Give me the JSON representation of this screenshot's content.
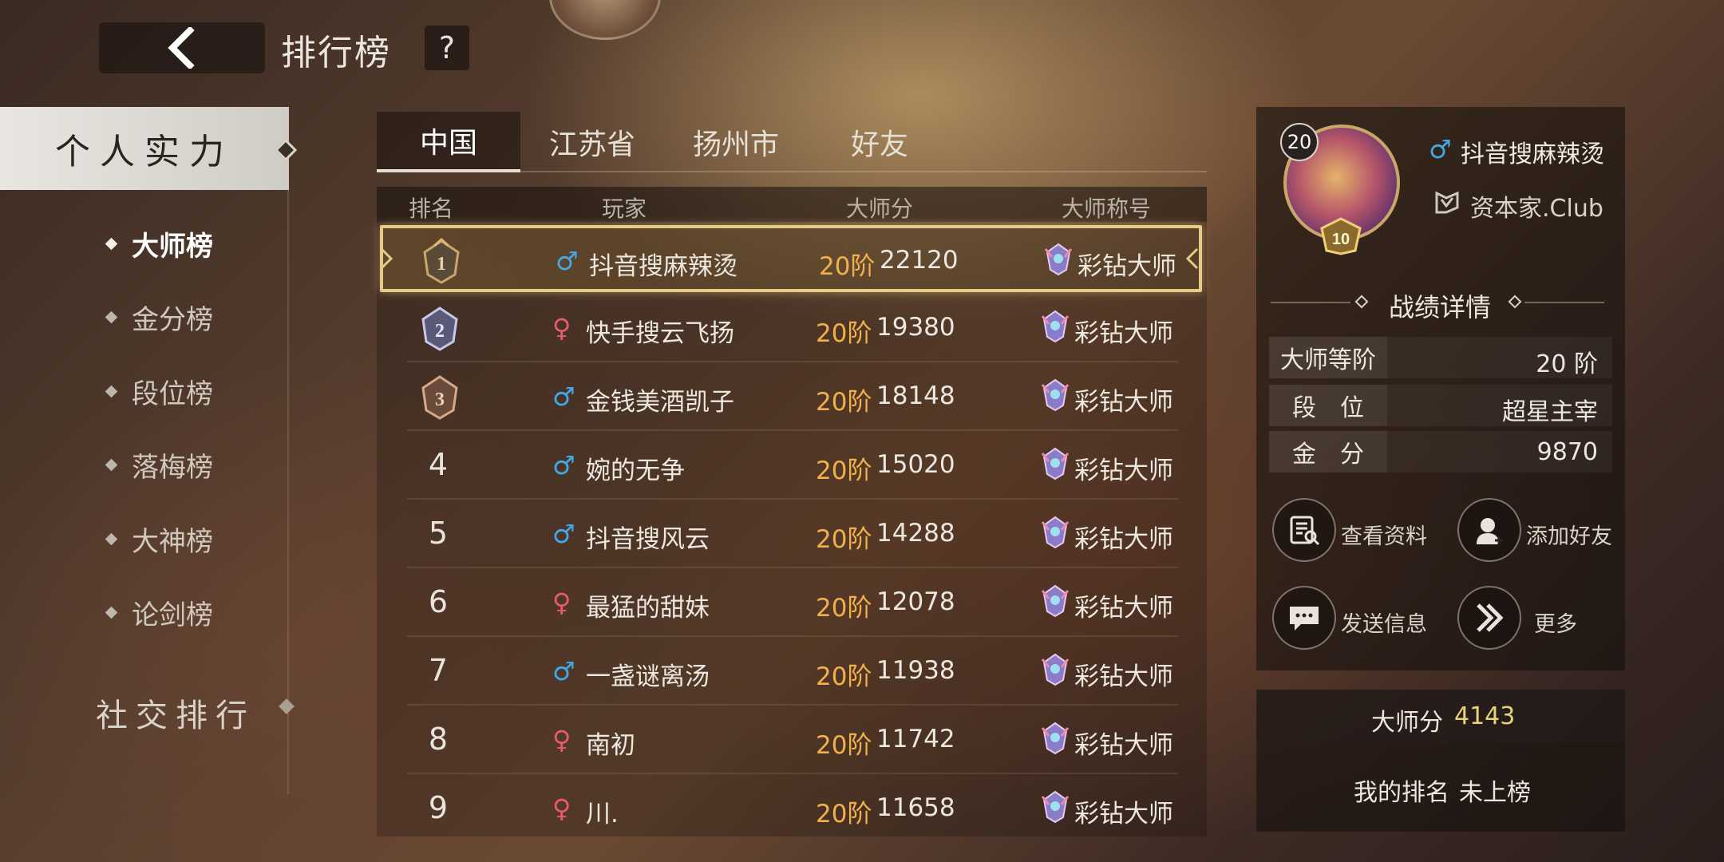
{
  "header": {
    "title": "排行榜",
    "help_label": "?"
  },
  "sidebar": {
    "main_label": "个人实力",
    "items": [
      {
        "label": "大师榜",
        "active": true
      },
      {
        "label": "金分榜",
        "active": false
      },
      {
        "label": "段位榜",
        "active": false
      },
      {
        "label": "落梅榜",
        "active": false
      },
      {
        "label": "大神榜",
        "active": false
      },
      {
        "label": "论剑榜",
        "active": false
      }
    ],
    "social_label": "社交排行"
  },
  "tabs": [
    {
      "label": "中国",
      "active": true
    },
    {
      "label": "江苏省",
      "active": false
    },
    {
      "label": "扬州市",
      "active": false
    },
    {
      "label": "好友",
      "active": false
    }
  ],
  "table": {
    "headers": [
      "排名",
      "玩家",
      "大师分",
      "大师称号"
    ],
    "rows": [
      {
        "rank": "1",
        "gender": "male",
        "name": "抖音搜麻辣烫",
        "tier": "20阶",
        "score": "22120",
        "title": "彩钻大师"
      },
      {
        "rank": "2",
        "gender": "female",
        "name": "快手搜云飞扬",
        "tier": "20阶",
        "score": "19380",
        "title": "彩钻大师"
      },
      {
        "rank": "3",
        "gender": "male",
        "name": "金钱美酒凯子",
        "tier": "20阶",
        "score": "18148",
        "title": "彩钻大师"
      },
      {
        "rank": "4",
        "gender": "male",
        "name": "婉的无争",
        "tier": "20阶",
        "score": "15020",
        "title": "彩钻大师"
      },
      {
        "rank": "5",
        "gender": "male",
        "name": "抖音搜风云",
        "tier": "20阶",
        "score": "14288",
        "title": "彩钻大师"
      },
      {
        "rank": "6",
        "gender": "female",
        "name": "最猛的甜妹",
        "tier": "20阶",
        "score": "12078",
        "title": "彩钻大师"
      },
      {
        "rank": "7",
        "gender": "male",
        "name": "一盏谜离汤",
        "tier": "20阶",
        "score": "11938",
        "title": "彩钻大师"
      },
      {
        "rank": "8",
        "gender": "female",
        "name": "南初",
        "tier": "20阶",
        "score": "11742",
        "title": "彩钻大师"
      },
      {
        "rank": "9",
        "gender": "female",
        "name": "川.",
        "tier": "20阶",
        "score": "11658",
        "title": "彩钻大师"
      }
    ]
  },
  "detail": {
    "level": "20",
    "rank_badge": "10",
    "name": "抖音搜麻辣烫",
    "club": "资本家.Club",
    "section_title": "战绩详情",
    "stats": [
      {
        "label": "大师等阶",
        "value": "20 阶"
      },
      {
        "label": "段　位",
        "value": "超星主宰"
      },
      {
        "label": "金　分",
        "value": "9870"
      }
    ],
    "actions": [
      {
        "label": "查看资料",
        "icon": "profile-doc-icon"
      },
      {
        "label": "添加好友",
        "icon": "add-friend-icon"
      },
      {
        "label": "发送信息",
        "icon": "chat-bubble-icon"
      },
      {
        "label": "更多",
        "icon": "double-chevron-right-icon"
      }
    ]
  },
  "mine": {
    "score_label": "大师分",
    "score_value": "4143",
    "rank_label": "我的排名",
    "rank_value": "未上榜"
  },
  "colors": {
    "accent_gold": "#f0b04a",
    "highlight_border": "#e6cb86",
    "male": "#42a8e8",
    "female": "#e85c6a"
  }
}
